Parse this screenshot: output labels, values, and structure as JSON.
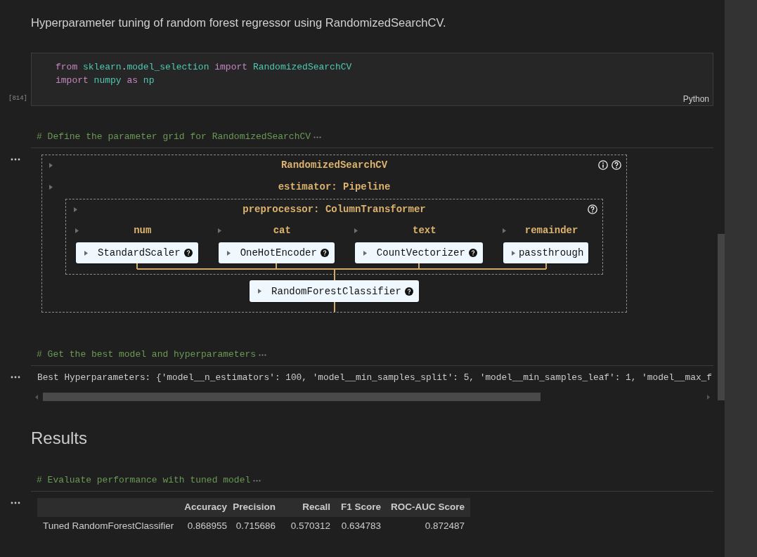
{
  "cells": [
    {
      "kind": "markdown",
      "text": "Hyperparameter tuning of random forest regressor using RandomizedSearchCV."
    },
    {
      "kind": "code",
      "execution_count": "[814]",
      "language": "Python",
      "lines": [
        [
          {
            "kind": "keyword",
            "text": "from "
          },
          {
            "kind": "name",
            "text": "sklearn"
          },
          {
            "kind": "plain",
            "text": "."
          },
          {
            "kind": "name",
            "text": "model_selection "
          },
          {
            "kind": "keyword",
            "text": "import "
          },
          {
            "kind": "name",
            "text": "RandomizedSearchCV"
          }
        ],
        [
          {
            "kind": "keyword",
            "text": "import "
          },
          {
            "kind": "name",
            "text": "numpy "
          },
          {
            "kind": "keyword",
            "text": "as "
          },
          {
            "kind": "name",
            "text": "np"
          }
        ]
      ]
    },
    {
      "kind": "collapsed_code",
      "summary": "# Define the parameter grid for RandomizedSearchCV",
      "output": {
        "kind": "estimator_diagram",
        "title": "RandomizedSearchCV",
        "estimator": "estimator: Pipeline",
        "preprocessor": "preprocessor: ColumnTransformer",
        "branches": [
          {
            "name": "num",
            "step": "StandardScaler",
            "help": true
          },
          {
            "name": "cat",
            "step": "OneHotEncoder",
            "help": true
          },
          {
            "name": "text",
            "step": "CountVectorizer",
            "help": true
          },
          {
            "name": "remainder",
            "step": "passthrough",
            "help": false
          }
        ],
        "final_step": {
          "step": "RandomForestClassifier",
          "help": true
        }
      }
    },
    {
      "kind": "collapsed_code",
      "summary": "# Get the best model and hyperparameters",
      "output": {
        "kind": "text",
        "text": "Best Hyperparameters: {'model__n_estimators': 100, 'model__min_samples_split': 5, 'model__min_samples_leaf': 1, 'model__max_f"
      }
    },
    {
      "kind": "heading",
      "text": "Results"
    },
    {
      "kind": "collapsed_code",
      "summary": "# Evaluate performance with tuned model",
      "output": {
        "kind": "table",
        "columns": [
          "Accuracy",
          "Precision",
          "Recall",
          "F1 Score",
          "ROC-AUC Score"
        ],
        "rows": [
          {
            "label": "Tuned RandomForestClassifier",
            "values": [
              "0.868955",
              "0.715686",
              "0.570312",
              "0.634783",
              "0.872487"
            ]
          }
        ]
      }
    }
  ]
}
